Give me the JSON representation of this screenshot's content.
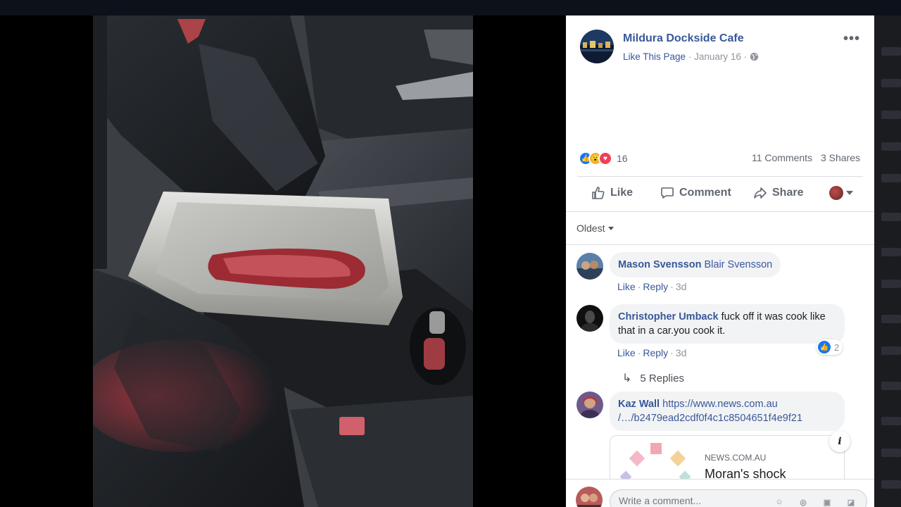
{
  "post": {
    "page_name": "Mildura Dockside Cafe",
    "like_page": "Like This Page",
    "date": "January 16",
    "separator": "·",
    "more": "•••"
  },
  "stats": {
    "reaction_count": "16",
    "comments": "11 Comments",
    "shares": "3 Shares",
    "reaction_icons": [
      "like-icon",
      "wow-icon",
      "love-icon"
    ]
  },
  "actions": {
    "like": "Like",
    "comment": "Comment",
    "share": "Share"
  },
  "sort": {
    "label": "Oldest"
  },
  "comments": [
    {
      "author": "Mason Svensson",
      "text": "Blair Svensson",
      "like": "Like",
      "reply": "Reply",
      "time": "3d"
    },
    {
      "author": "Christopher Umback",
      "text": "fuck off it was cook like that in a car.you cook it.",
      "like": "Like",
      "reply": "Reply",
      "time": "3d",
      "reactions": "2",
      "replies": "5 Replies"
    },
    {
      "author": "Kaz Wall",
      "text_line1": "https://www.news.com.au",
      "text_line2": "/…/b2479ead2cdf0f4c1c8504651f4e9f21",
      "link_domain": "NEWS.COM.AU",
      "link_title": "Moran's shock"
    }
  ],
  "composer": {
    "placeholder": "Write a comment..."
  },
  "colors": {
    "link": "#385898",
    "meta": "#90949c",
    "like_blue": "#1877f2"
  }
}
